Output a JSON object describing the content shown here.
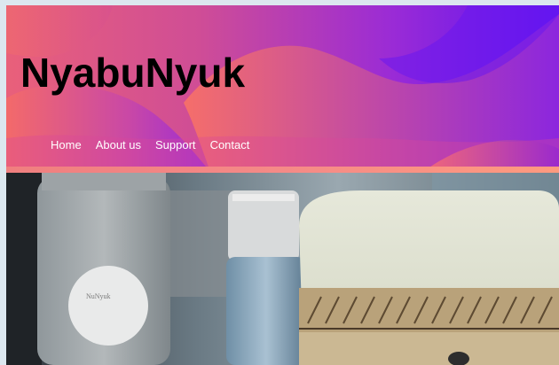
{
  "site": {
    "title": "NyabuNyuk"
  },
  "nav": {
    "items": [
      {
        "label": "Home"
      },
      {
        "label": "About us"
      },
      {
        "label": "Support"
      },
      {
        "label": "Contact"
      }
    ]
  },
  "hero": {
    "image": "product-photo-soap-and-bottles",
    "bottle_label_text": "NuNyuk"
  },
  "colors": {
    "header_gradient_start": "#e9607a",
    "header_gradient_end": "#5c12f3",
    "title": "#000000",
    "nav_text": "#ffffff"
  }
}
